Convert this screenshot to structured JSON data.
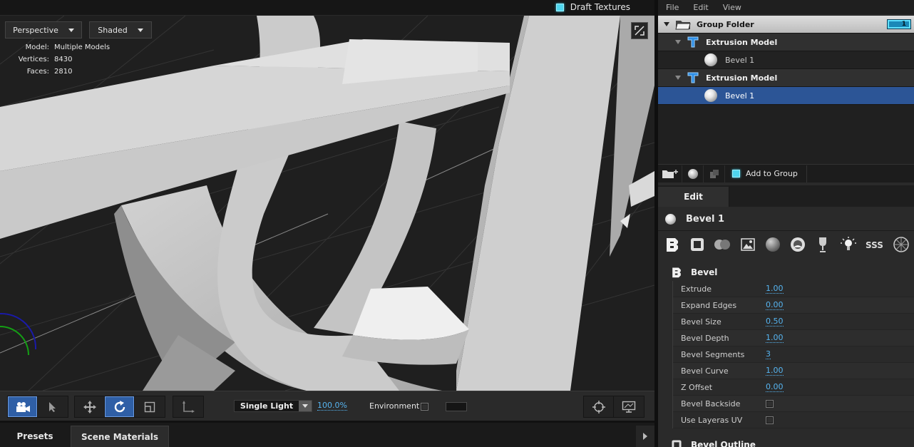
{
  "viewport": {
    "draft_textures_label": "Draft Textures",
    "camera_mode": "Perspective",
    "shading_mode": "Shaded",
    "stats": [
      {
        "label": "Model:",
        "value": "Multiple Models"
      },
      {
        "label": "Vertices:",
        "value": "8430"
      },
      {
        "label": "Faces:",
        "value": "2810"
      }
    ]
  },
  "toolbar": {
    "light_mode": "Single Light",
    "zoom": "100.0%",
    "environment_label": "Environment",
    "environment_checked": false
  },
  "bottom_tabs": {
    "presets": "Presets",
    "scene_materials": "Scene Materials"
  },
  "menu": {
    "file": "File",
    "edit": "Edit",
    "view": "View"
  },
  "tree": {
    "group_label": "Group Folder",
    "group_badge": "1",
    "models": [
      {
        "label": "Extrusion Model",
        "material": "Bevel 1",
        "selected": false
      },
      {
        "label": "Extrusion Model",
        "material": "Bevel 1",
        "selected": true
      }
    ]
  },
  "tree_tools": {
    "add_to_group": "Add to Group"
  },
  "edit_panel": {
    "tab_label": "Edit",
    "material_name": "Bevel 1",
    "icons": [
      "bevel-icon",
      "bevel-outline-icon",
      "materials-icon",
      "image-icon",
      "sphere-icon",
      "environment-icon",
      "goblet-icon",
      "light-icon",
      "sss-icon",
      "reflection-icon"
    ],
    "section_title": "Bevel",
    "properties": [
      {
        "name": "Extrude",
        "value": "1.00",
        "type": "number"
      },
      {
        "name": "Expand Edges",
        "value": "0.00",
        "type": "number"
      },
      {
        "name": "Bevel Size",
        "value": "0.50",
        "type": "number"
      },
      {
        "name": "Bevel Depth",
        "value": "1.00",
        "type": "number"
      },
      {
        "name": "Bevel Segments",
        "value": "3",
        "type": "number"
      },
      {
        "name": "Bevel Curve",
        "value": "1.00",
        "type": "number"
      },
      {
        "name": "Z Offset",
        "value": "0.00",
        "type": "number"
      },
      {
        "name": "Bevel Backside",
        "value": false,
        "type": "checkbox"
      },
      {
        "name": "Use Layeras UV",
        "value": false,
        "type": "checkbox"
      }
    ],
    "next_section": "Bevel Outline"
  },
  "colors": {
    "accent_blue": "#56b4f0",
    "selection": "#2c5596",
    "cyan": "#4fd6ef"
  }
}
